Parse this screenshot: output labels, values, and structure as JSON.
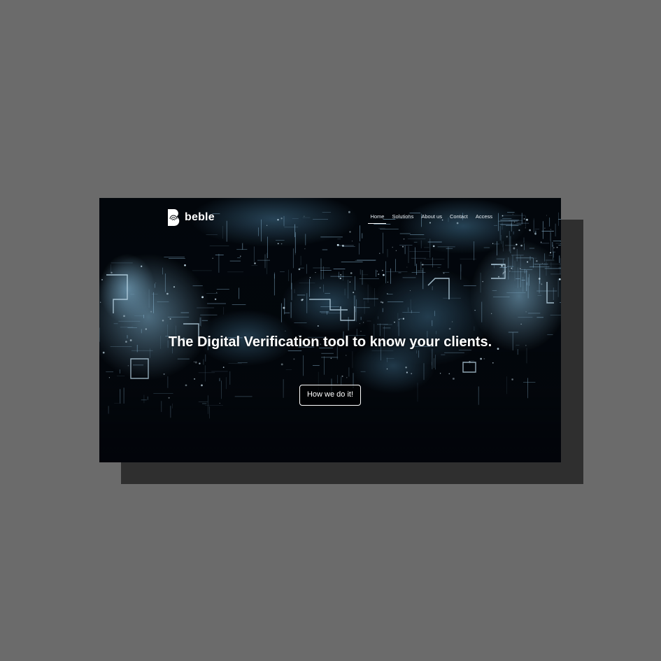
{
  "brand": {
    "name": "beble",
    "logo_icon": "b-fingerprint-logo"
  },
  "nav": {
    "items": [
      {
        "label": "Home",
        "active": true
      },
      {
        "label": "Solutions",
        "active": false
      },
      {
        "label": "About us",
        "active": false
      },
      {
        "label": "Contact",
        "active": false
      },
      {
        "label": "Access",
        "active": false
      }
    ]
  },
  "hero": {
    "title": "The Digital Verification tool to know your clients.",
    "cta_label": "How we do it!",
    "background": "digital-network-world-map"
  },
  "colors": {
    "page_bg": "#6b6b6b",
    "shadow": "#2f2f2f",
    "site_bg": "#03060a",
    "accent_glow": "#8fd3ff",
    "text": "#ffffff"
  }
}
